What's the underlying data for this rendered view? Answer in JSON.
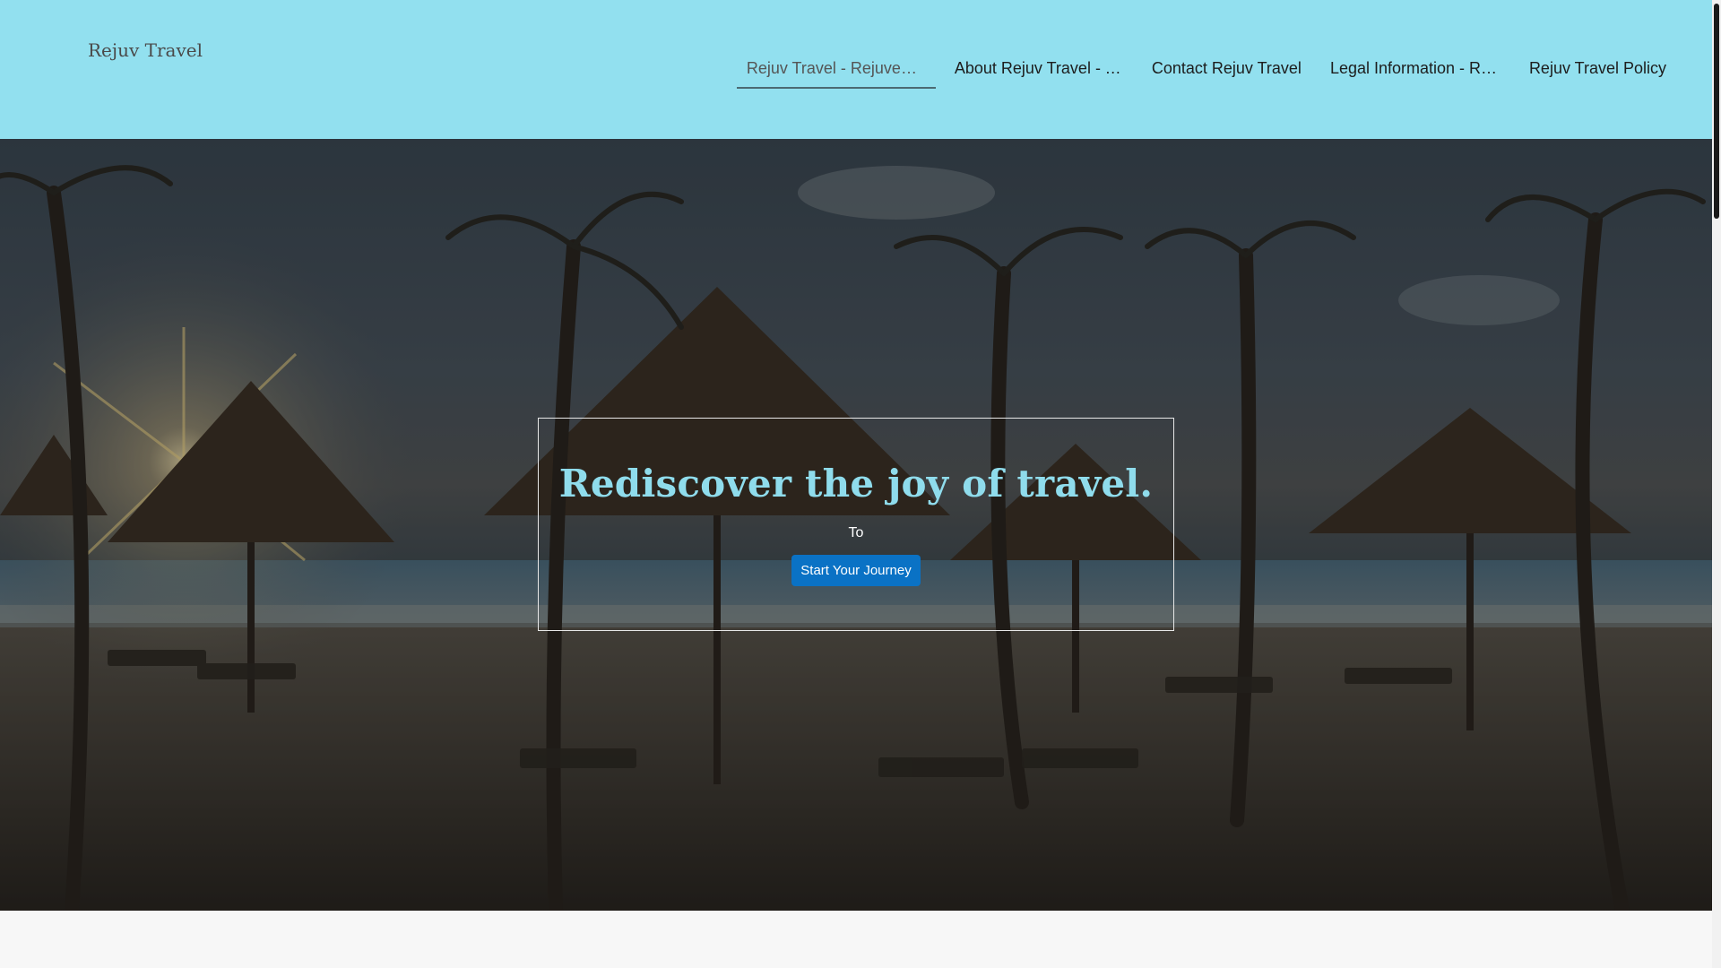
{
  "header": {
    "brand": "Rejuv Travel",
    "nav": [
      {
        "label": "Rejuv Travel - Rejuvenat…",
        "active": true
      },
      {
        "label": "About Rejuv Travel - You…",
        "active": false
      },
      {
        "label": "Contact Rejuv Travel",
        "active": false
      },
      {
        "label": "Legal Information - Reju…",
        "active": false
      },
      {
        "label": "Rejuv Travel Policy",
        "active": false
      }
    ],
    "background_color": "#92e0ef"
  },
  "hero": {
    "title": "Rediscover the joy of travel.",
    "subtitle": "To",
    "cta_label": "Start Your Journey",
    "title_color": "#8fdcec",
    "cta_color": "#0a72c5",
    "image": "beach-with-palm-trees-and-thatched-umbrellas-at-sunset"
  },
  "colors": {
    "page_background": "#f7f7f7"
  }
}
